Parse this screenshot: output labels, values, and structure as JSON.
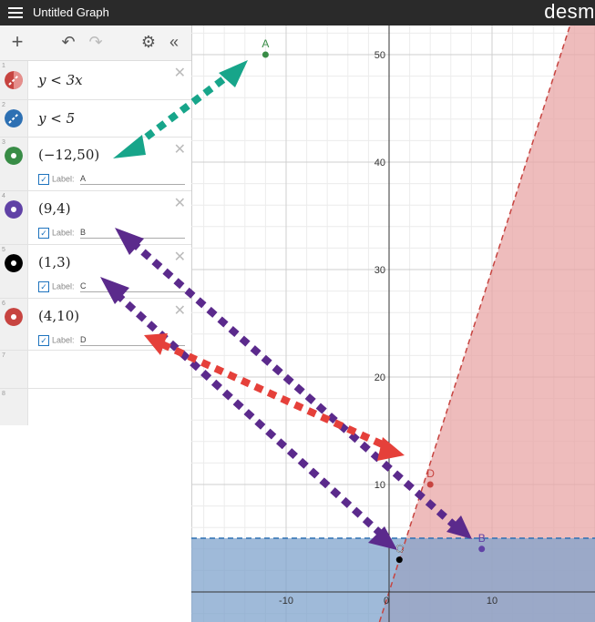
{
  "header": {
    "title": "Untitled Graph",
    "brand": "desm"
  },
  "expressions": [
    {
      "num": "1",
      "latex": "y < 3x",
      "color": "#c74440",
      "style": "dashed"
    },
    {
      "num": "2",
      "latex": "y < 5",
      "color": "#2d70b3",
      "style": "dashed"
    },
    {
      "num": "3",
      "latex": "(−12,50)",
      "color": "#388c46",
      "checkbox_label": "Label:",
      "label_value": "A"
    },
    {
      "num": "4",
      "latex": "(9,4)",
      "color": "#6042a6",
      "checkbox_label": "Label:",
      "label_value": "B"
    },
    {
      "num": "5",
      "latex": "(1,3)",
      "color": "#000000",
      "checkbox_label": "Label:",
      "label_value": "C"
    },
    {
      "num": "6",
      "latex": "(4,10)",
      "color": "#c74440",
      "checkbox_label": "Label:",
      "label_value": "D"
    },
    {
      "num": "7"
    },
    {
      "num": "8"
    }
  ],
  "graph": {
    "y_ticks": [
      "50",
      "40",
      "30",
      "20",
      "10"
    ],
    "x_ticks": [
      "-10",
      "0",
      "10"
    ],
    "points": [
      {
        "label": "A",
        "x": -12,
        "y": 50,
        "color": "#388c46"
      },
      {
        "label": "B",
        "x": 9,
        "y": 4,
        "color": "#6042a6"
      },
      {
        "label": "C",
        "x": 1,
        "y": 3,
        "color": "#000000"
      },
      {
        "label": "D",
        "x": 4,
        "y": 10,
        "color": "#c74440"
      }
    ],
    "annotation_colors": {
      "teal": "#17a58a",
      "purple": "#5b2a8c",
      "red": "#e5403a"
    }
  }
}
